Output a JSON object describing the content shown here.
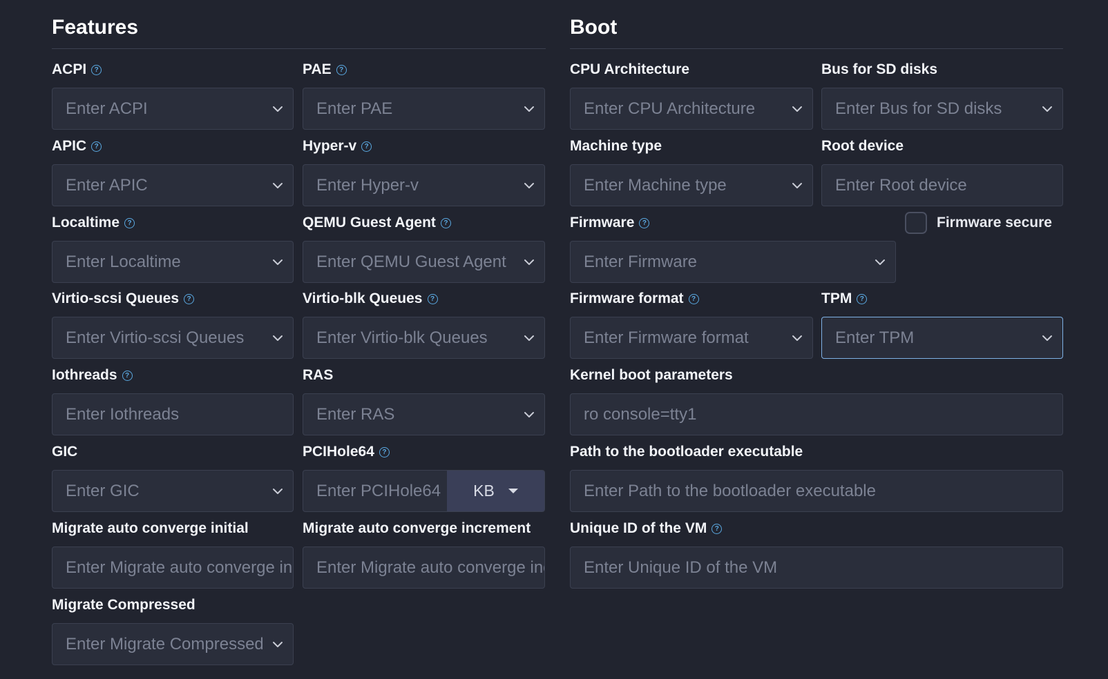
{
  "features": {
    "title": "Features",
    "fields": [
      {
        "label": "ACPI",
        "placeholder": "Enter ACPI",
        "help": true,
        "kind": "select"
      },
      {
        "label": "PAE",
        "placeholder": "Enter PAE",
        "help": true,
        "kind": "select"
      },
      {
        "label": "APIC",
        "placeholder": "Enter APIC",
        "help": true,
        "kind": "select"
      },
      {
        "label": "Hyper-v",
        "placeholder": "Enter Hyper-v",
        "help": true,
        "kind": "select"
      },
      {
        "label": "Localtime",
        "placeholder": "Enter Localtime",
        "help": true,
        "kind": "select"
      },
      {
        "label": "QEMU Guest Agent",
        "placeholder": "Enter QEMU Guest Agent",
        "help": true,
        "kind": "select"
      },
      {
        "label": "Virtio-scsi Queues",
        "placeholder": "Enter Virtio-scsi Queues",
        "help": true,
        "kind": "select"
      },
      {
        "label": "Virtio-blk Queues",
        "placeholder": "Enter Virtio-blk Queues",
        "help": true,
        "kind": "select"
      },
      {
        "label": "Iothreads",
        "placeholder": "Enter Iothreads",
        "help": true,
        "kind": "text"
      },
      {
        "label": "RAS",
        "placeholder": "Enter RAS",
        "help": false,
        "kind": "select"
      },
      {
        "label": "GIC",
        "placeholder": "Enter GIC",
        "help": false,
        "kind": "select"
      },
      {
        "label": "PCIHole64",
        "placeholder": "Enter PCIHole64",
        "help": true,
        "kind": "unit",
        "unit": "KB"
      },
      {
        "label": "Migrate auto converge initial",
        "placeholder": "Enter Migrate auto converge initial",
        "help": false,
        "kind": "text"
      },
      {
        "label": "Migrate auto converge increment",
        "placeholder": "Enter Migrate auto converge increment",
        "help": false,
        "kind": "text"
      },
      {
        "label": "Migrate Compressed",
        "placeholder": "Enter Migrate Compressed",
        "help": false,
        "kind": "select"
      }
    ]
  },
  "boot": {
    "title": "Boot",
    "fields": [
      {
        "label": "CPU Architecture",
        "placeholder": "Enter CPU Architecture",
        "help": false,
        "kind": "select"
      },
      {
        "label": "Bus for SD disks",
        "placeholder": "Enter Bus for SD disks",
        "help": false,
        "kind": "select"
      },
      {
        "label": "Machine type",
        "placeholder": "Enter Machine type",
        "help": false,
        "kind": "select"
      },
      {
        "label": "Root device",
        "placeholder": "Enter Root device",
        "help": false,
        "kind": "text"
      },
      {
        "label": "Firmware",
        "placeholder": "Enter Firmware",
        "help": true,
        "kind": "select"
      },
      {
        "label": "Firmware format",
        "placeholder": "Enter Firmware format",
        "help": true,
        "kind": "select"
      },
      {
        "label": "TPM",
        "placeholder": "Enter TPM",
        "help": true,
        "kind": "select",
        "focused": true
      },
      {
        "label": "Kernel boot parameters",
        "placeholder": "ro console=tty1",
        "help": false,
        "kind": "text"
      },
      {
        "label": "Path to the bootloader executable",
        "placeholder": "Enter Path to the bootloader executable",
        "help": false,
        "kind": "text"
      },
      {
        "label": "Unique ID of the VM",
        "placeholder": "Enter Unique ID of the VM",
        "help": true,
        "kind": "text"
      }
    ],
    "firmware_secure": {
      "label": "Firmware secure",
      "checked": false
    }
  },
  "colors": {
    "background": "#21242f",
    "input_bg": "#2a2e3b",
    "border": "#3b4050",
    "focus_border": "#7fb2e6",
    "help_icon": "#5aa8e0",
    "unit_bg": "#3a3f58"
  }
}
